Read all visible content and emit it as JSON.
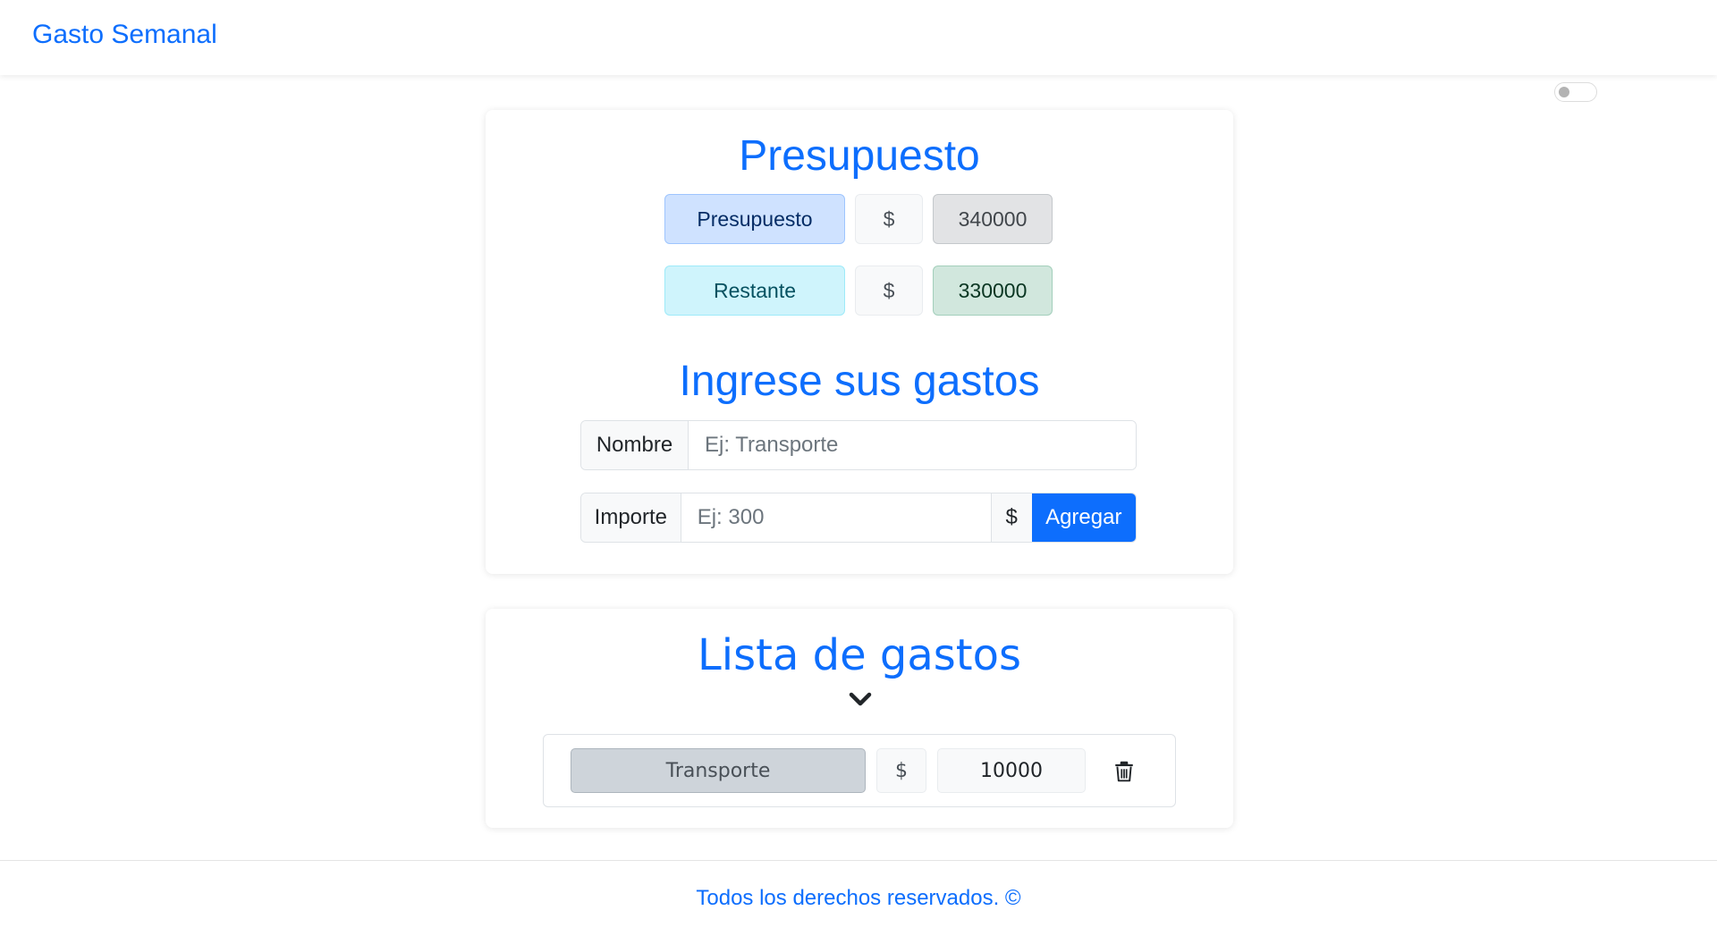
{
  "navbar": {
    "brand": "Gasto Semanal"
  },
  "theme_toggle": {
    "state": "off"
  },
  "budget_section": {
    "title": "Presupuesto",
    "budget_label": "Presupuesto",
    "budget_currency": "$",
    "budget_value": "340000",
    "remaining_label": "Restante",
    "remaining_currency": "$",
    "remaining_value": "330000"
  },
  "expense_form": {
    "title": "Ingrese sus gastos",
    "name_label": "Nombre",
    "name_placeholder": "Ej: Transporte",
    "amount_label": "Importe",
    "amount_placeholder": "Ej: 300",
    "amount_currency": "$",
    "add_button": "Agregar"
  },
  "expense_list": {
    "title": "Lista de gastos",
    "toggle_icon": "chevron-down-icon",
    "items": [
      {
        "name": "Transporte",
        "currency": "$",
        "amount": "10000",
        "delete_icon": "trash-icon"
      }
    ]
  },
  "footer": {
    "text": "Todos los derechos reservados. ©"
  },
  "colors": {
    "primary": "#0d6efd",
    "budget_label_bg": "#cfe2ff",
    "remaining_label_bg": "#cff4fc",
    "budget_value_bg": "#e2e3e5",
    "remaining_value_bg": "#d1e7dd",
    "item_name_bg": "#ced4da"
  }
}
